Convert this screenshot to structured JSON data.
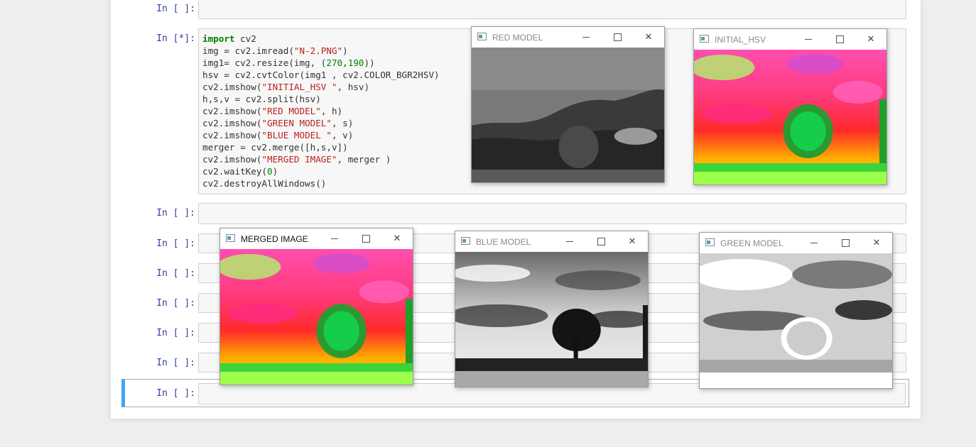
{
  "cells": [
    {
      "prompt": "In [ ]:"
    },
    {
      "prompt": "In [*]:"
    },
    {
      "prompt": "In [ ]:"
    },
    {
      "prompt": "In [ ]:"
    },
    {
      "prompt": "In [ ]:"
    },
    {
      "prompt": "In [ ]:"
    },
    {
      "prompt": "In [ ]:"
    },
    {
      "prompt": "In [ ]:"
    },
    {
      "prompt": "In [ ]:"
    }
  ],
  "code": {
    "l1_kw": "import",
    "l1_rest": " cv2",
    "l2_a": "img = cv2.imread(",
    "l2_s": "\"N-2.PNG\"",
    "l2_b": ")",
    "l3_a": "img1= cv2.resize(img, (",
    "l3_n1": "270",
    "l3_c": ",",
    "l3_n2": "190",
    "l3_b": "))",
    "l4": "hsv = cv2.cvtColor(img1 , cv2.COLOR_BGR2HSV)",
    "l5_a": "cv2.imshow(",
    "l5_s": "\"INITIAL_HSV \"",
    "l5_b": ", hsv)",
    "l6": "h,s,v = cv2.split(hsv)",
    "l7_a": "cv2.imshow(",
    "l7_s": "\"RED MODEL\"",
    "l7_b": ", h)",
    "l8_a": "cv2.imshow(",
    "l8_s": "\"GREEN MODEL\"",
    "l8_b": ", s)",
    "l9_a": "cv2.imshow(",
    "l9_s": "\"BLUE MODEL \"",
    "l9_b": ", v)",
    "l10": "merger = cv2.merge([h,s,v])",
    "l11_a": "cv2.imshow(",
    "l11_s": "\"MERGED IMAGE\"",
    "l11_b": ", merger )",
    "l12_a": "cv2.waitKey(",
    "l12_n": "0",
    "l12_b": ")",
    "l13": "cv2.destroyAllWindows()"
  },
  "windows": {
    "red": {
      "title": "RED MODEL",
      "active": false
    },
    "initial_hsv": {
      "title": "INITIAL_HSV",
      "active": false
    },
    "merged": {
      "title": "MERGED IMAGE",
      "active": true
    },
    "blue": {
      "title": "BLUE MODEL",
      "active": false
    },
    "green": {
      "title": "GREEN MODEL",
      "active": false
    }
  },
  "controls": {
    "minimize_icon": "minimize-icon",
    "maximize_icon": "maximize-icon",
    "close_icon": "close-icon",
    "close_glyph": "✕"
  },
  "colors": {
    "prompt": "#303f9f",
    "keyword": "#008000",
    "string": "#ba2121",
    "selected_cell_bar": "#42a5f5"
  }
}
